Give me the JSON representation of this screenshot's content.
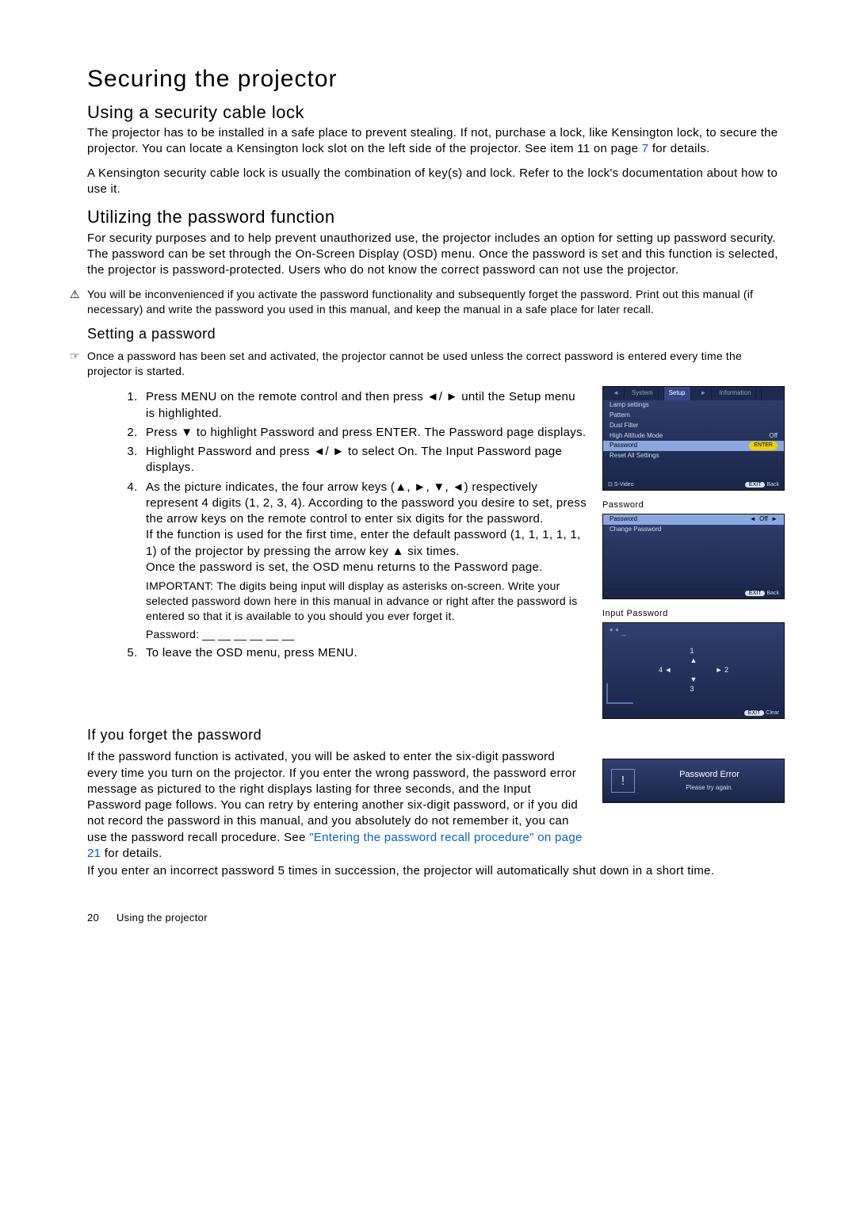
{
  "page": {
    "title": "Securing the projector",
    "section1": {
      "heading": "Using a security cable lock",
      "p1a": "The projector has to be installed in a safe place to prevent stealing. If not, purchase a lock, like Kensington lock, to secure the projector. You can locate a Kensington lock slot on the left side of the projector. See item 11 on page ",
      "p1_link": "7",
      "p1b": " for details.",
      "p2": "A Kensington security cable lock is usually the combination of key(s) and lock. Refer to the lock's documentation about how to use it."
    },
    "section2": {
      "heading": "Utilizing the password function",
      "p1": "For security purposes and to help prevent unauthorized use, the projector includes an option for setting up password security. The password can be set through the On-Screen Display (OSD) menu. Once the password is set and this function is selected, the projector is password-protected. Users who do not know the correct password can not use the projector.",
      "warn": "You will be inconvenienced if you activate the password functionality and subsequently forget the password. Print out this manual (if necessary) and write the password you used in this manual, and keep the manual in a safe place for later recall."
    },
    "setting": {
      "heading": "Setting a password",
      "note": "Once a password has been set and activated, the projector cannot be used unless the correct password is entered every time the projector is started.",
      "step1": "Press MENU on the remote control and then press ◄/ ► until the Setup menu is highlighted.",
      "step2": "Press ▼ to highlight Password and press ENTER. The Password page displays.",
      "step3": "Highlight Password and press ◄/ ► to select On. The Input Password page displays.",
      "step4a": "As the picture indicates, the four arrow keys (▲, ►, ▼, ◄) respectively represent 4 digits (1, 2, 3, 4). According to the password you desire to set, press the arrow keys on the remote control to enter six digits for the password.",
      "step4b": "If the function is used for the first time, enter the default password (1, 1, 1, 1, 1, 1) of the projector by pressing the arrow key ▲ six times.",
      "step4c": "Once the password is set, the OSD menu returns to the Password page.",
      "step4_important": "IMPORTANT: The digits being input will display as asterisks on-screen. Write your selected password down here in this manual in advance or right after the password is entered so that it is available to you should you ever forget it.",
      "step4_pwline": "Password: __ __ __ __ __ __",
      "step5": "To leave the OSD menu, press MENU."
    },
    "forget": {
      "heading": "If you forget the password",
      "p1a": "If the password function is activated, you will be asked to enter the six-digit password every time you turn on the projector. If you enter the wrong password, the password error message as pictured to the right displays lasting for three seconds, and the Input Password page follows. You can retry by entering another six-digit password, or if you did not record the password in this manual, and you absolutely do not remember it, you can use the password recall procedure. See ",
      "p1_link": "\"Entering the password recall procedure\" on page 21",
      "p1b": " for details.",
      "p2": "If you enter an incorrect password 5 times in succession, the projector will automatically shut down in a short time."
    },
    "osd1": {
      "tabs": {
        "a": "System",
        "b": "Setup",
        "c": "Information"
      },
      "rows": {
        "r1": "Lamp settings",
        "r2": "Pattern",
        "r3": "Dust Filter",
        "r4": "High Altitude Mode",
        "r4v": "Off",
        "r5": "Password",
        "r5v": "ENTER",
        "r6": "Reset All Settings"
      },
      "src": "S-Video",
      "exit": "EXIT",
      "back": "Back"
    },
    "osd2": {
      "title": "Password",
      "row1": "Password",
      "row1v": "Off",
      "row2": "Change Password",
      "exit": "EXIT",
      "back": "Back"
    },
    "osd3": {
      "title": "Input Password",
      "stars": "* *",
      "n": "1",
      "e": "2",
      "s": "3",
      "w": "4",
      "exit": "EXIT",
      "clear": "Clear"
    },
    "err": {
      "title": "Password Error",
      "msg": "Please try again."
    },
    "footer": {
      "page": "20",
      "section": "Using the projector"
    }
  }
}
